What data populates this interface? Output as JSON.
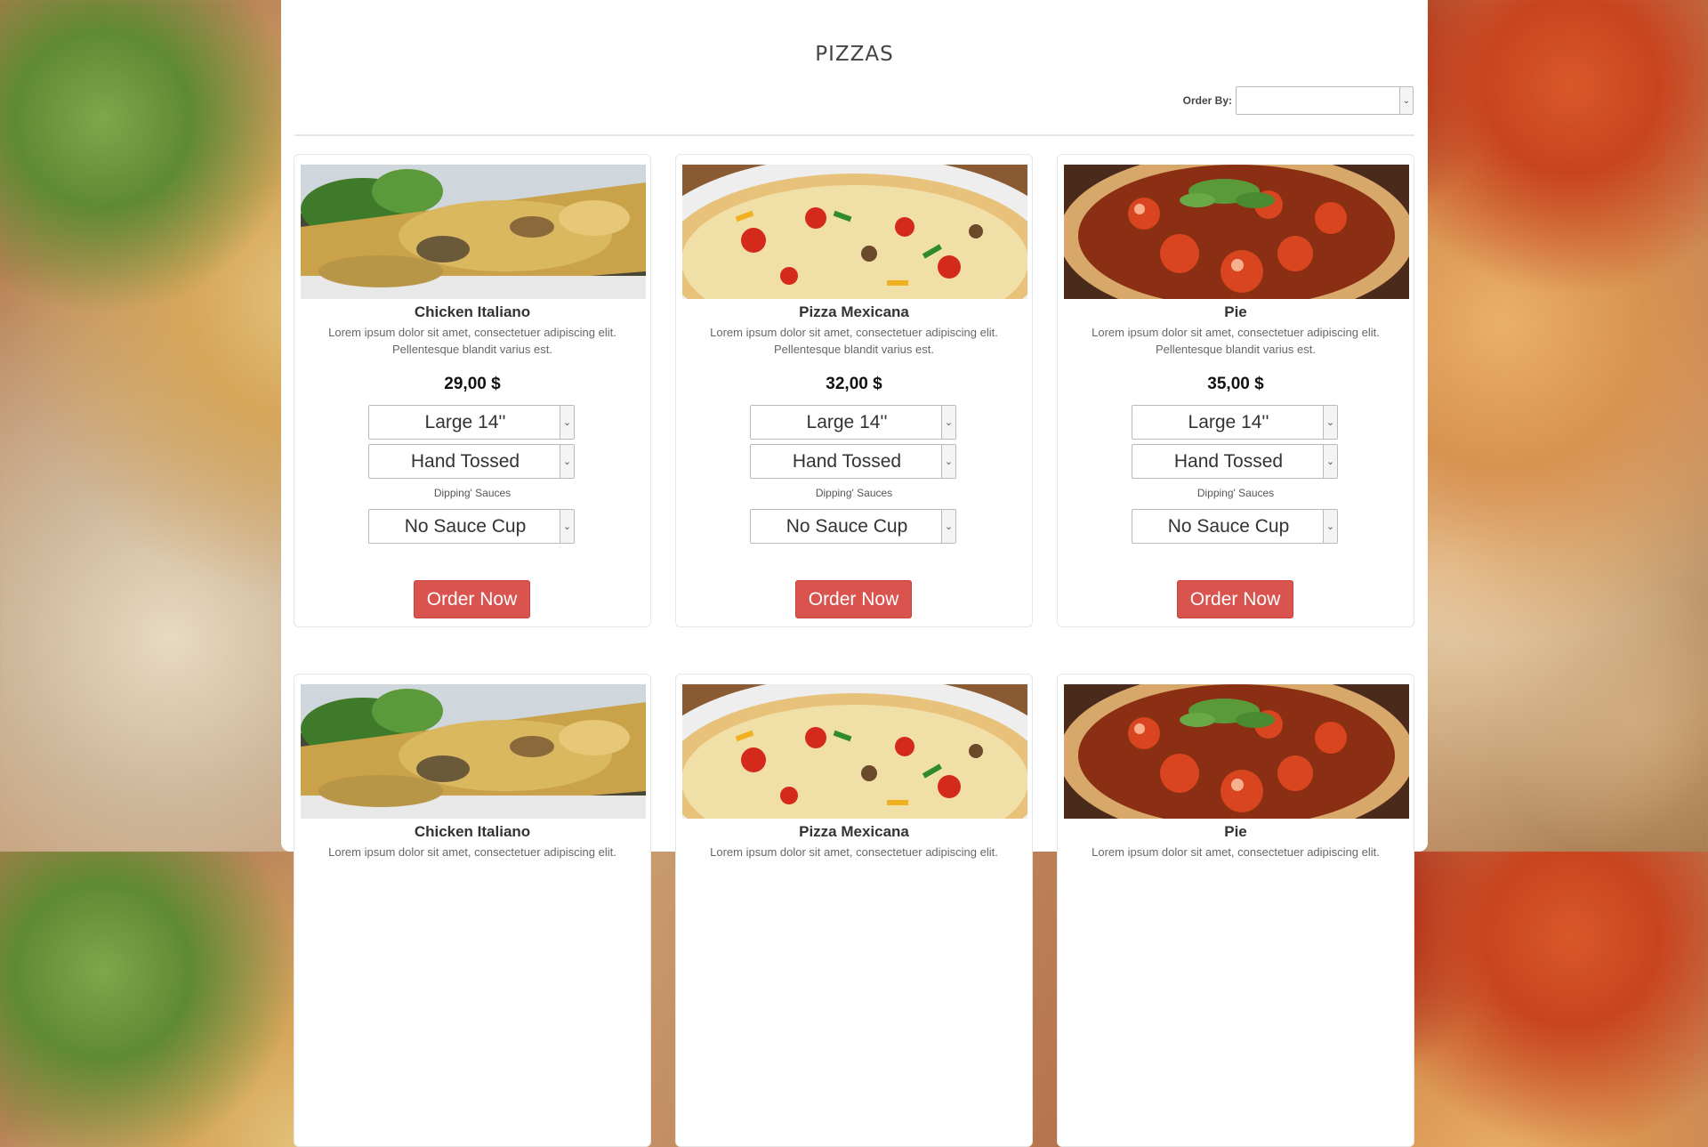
{
  "page": {
    "title": "PIZZAS"
  },
  "order_by": {
    "label": "Order By:",
    "value": ""
  },
  "common": {
    "sauce_label": "Dipping' Sauces",
    "order_button": "Order Now"
  },
  "products": [
    {
      "name": "Chicken Italiano",
      "description": "Lorem ipsum dolor sit amet, consectetuer adipiscing elit. Pellentesque blandit varius est.",
      "price": "29,00 $",
      "size": "Large 14''",
      "crust": "Hand Tossed",
      "sauce": "No Sauce Cup"
    },
    {
      "name": "Pizza Mexicana",
      "description": "Lorem ipsum dolor sit amet, consectetuer adipiscing elit. Pellentesque blandit varius est.",
      "price": "32,00 $",
      "size": "Large 14''",
      "crust": "Hand Tossed",
      "sauce": "No Sauce Cup"
    },
    {
      "name": "Pie",
      "description": "Lorem ipsum dolor sit amet, consectetuer adipiscing elit. Pellentesque blandit varius est.",
      "price": "35,00 $",
      "size": "Large 14''",
      "crust": "Hand Tossed",
      "sauce": "No Sauce Cup"
    },
    {
      "name": "Chicken Italiano",
      "description": "Lorem ipsum dolor sit amet, consectetuer adipiscing elit.",
      "price": "",
      "size": "",
      "crust": "",
      "sauce": ""
    },
    {
      "name": "Pizza Mexicana",
      "description": "Lorem ipsum dolor sit amet, consectetuer adipiscing elit.",
      "price": "",
      "size": "",
      "crust": "",
      "sauce": ""
    },
    {
      "name": "Pie",
      "description": "Lorem ipsum dolor sit amet, consectetuer adipiscing elit.",
      "price": "",
      "size": "",
      "crust": "",
      "sauce": ""
    }
  ],
  "icons": {
    "dropdown": "chevron-down-icon"
  },
  "colors": {
    "order_button": "#d9534f",
    "panel": "#ffffff"
  }
}
